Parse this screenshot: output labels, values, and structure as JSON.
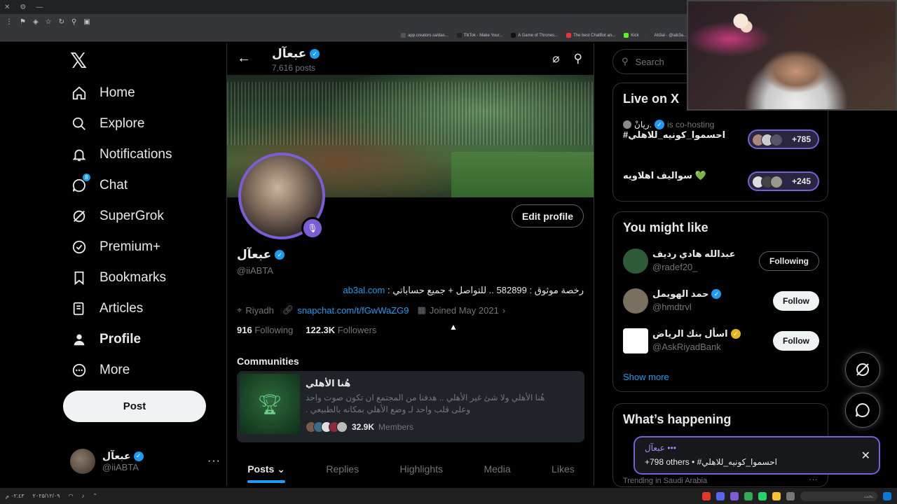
{
  "browser": {
    "bookmarks": [
      {
        "label": "app.creators.sa/das...",
        "color": "#555"
      },
      {
        "label": "TikTok - Make Your...",
        "color": "#222"
      },
      {
        "label": "A Game of Thrones...",
        "color": "#111"
      },
      {
        "label": "The best ChatBot an...",
        "color": "#e33"
      },
      {
        "label": "Kick",
        "color": "#53fc18"
      },
      {
        "label": "Ab3al - @iab3a...",
        "color": "#333"
      }
    ]
  },
  "nav": {
    "logo": "𝕏",
    "items": [
      {
        "label": "Home",
        "icon": "⌂"
      },
      {
        "label": "Explore",
        "icon": "⚲"
      },
      {
        "label": "Notifications",
        "icon": "🔔︎"
      },
      {
        "label": "Chat",
        "icon": "◯",
        "badge": "8"
      },
      {
        "label": "SuperGrok",
        "icon": "⌀"
      },
      {
        "label": "Premium+",
        "icon": "✓"
      },
      {
        "label": "Bookmarks",
        "icon": "⚑"
      },
      {
        "label": "Articles",
        "icon": "✎"
      },
      {
        "label": "Profile",
        "icon": "●"
      },
      {
        "label": "More",
        "icon": "⋯"
      }
    ],
    "post_label": "Post",
    "account": {
      "name": "عبعآل",
      "handle": "@iiABTA",
      "more": "···"
    }
  },
  "header": {
    "back_icon": "←",
    "name": "عبعآل",
    "posts_count": "7,616 posts",
    "grok_icon": "⌀",
    "search_icon": "⚲"
  },
  "profile": {
    "edit_label": "Edit profile",
    "name": "عبعآل",
    "handle": "@iiABTA",
    "bio_text": "رخصة موثوق : 582899 .. للتواصل + جميع حساباتي :",
    "bio_link": "ab3al.com",
    "location": "Riyadh",
    "website": "snapchat.com/t/fGwWaZG9",
    "joined": "Joined May 2021",
    "following_count": "916",
    "following_label": "Following",
    "followers_count": "122.3K",
    "followers_label": "Followers"
  },
  "communities": {
    "heading": "Communities",
    "title": "هُنا الأهلي",
    "description": "هُنا الأهلي ولا شئ غير الأهلي .. هدفنا من المجتمع ان تكون صوت واحد وعلى قلب واحد لـ وضع الأهلي بمكانه بالطبيعي .",
    "members_count": "32.9K",
    "members_label": "Members"
  },
  "tabs": [
    "Posts",
    "Replies",
    "Highlights",
    "Media",
    "Likes"
  ],
  "search": {
    "placeholder": "Search"
  },
  "live": {
    "title": "Live on X",
    "items": [
      {
        "host": "ريانْ.",
        "host_suffix": "is co-hosting",
        "topic": "#احسموا_كونيه_للاهلي",
        "count": "+785"
      },
      {
        "topic": "سواليف اهلاويه 💚",
        "count": "+245"
      }
    ]
  },
  "might_like": {
    "title": "You might like",
    "items": [
      {
        "name": "عبدالله هادي رديف",
        "handle": "@radef20_",
        "button": "Following",
        "avatar_color": "#2e5a38"
      },
      {
        "name": "حمد الهويمل",
        "handle": "@hmdtrvl",
        "button": "Follow",
        "avatar_color": "#7a7060"
      },
      {
        "name": "اسأل بنك الرياض",
        "handle": "@AskRiyadBank",
        "button": "Follow",
        "avatar_color": "#ffffff"
      }
    ],
    "show_more": "Show more"
  },
  "happening": {
    "title": "What’s happening",
    "trend_label": "Trending in Saudi Arabia",
    "more": "···"
  },
  "toast": {
    "line1": "عبعآل •••",
    "line2": "+798 others • #احسموا_كونيه_للاهلي",
    "close": "✕"
  },
  "taskbar": {
    "time": "٠٢:٤٣ م",
    "date": "٢٠٢٥/١٢/٠٩",
    "search_placeholder": "بحث",
    "url_hint": "https://x.com/iiABTA"
  },
  "colors": {
    "accent": "#1d9bf0",
    "spaces": "#7b5dd6",
    "bg": "#000000"
  }
}
